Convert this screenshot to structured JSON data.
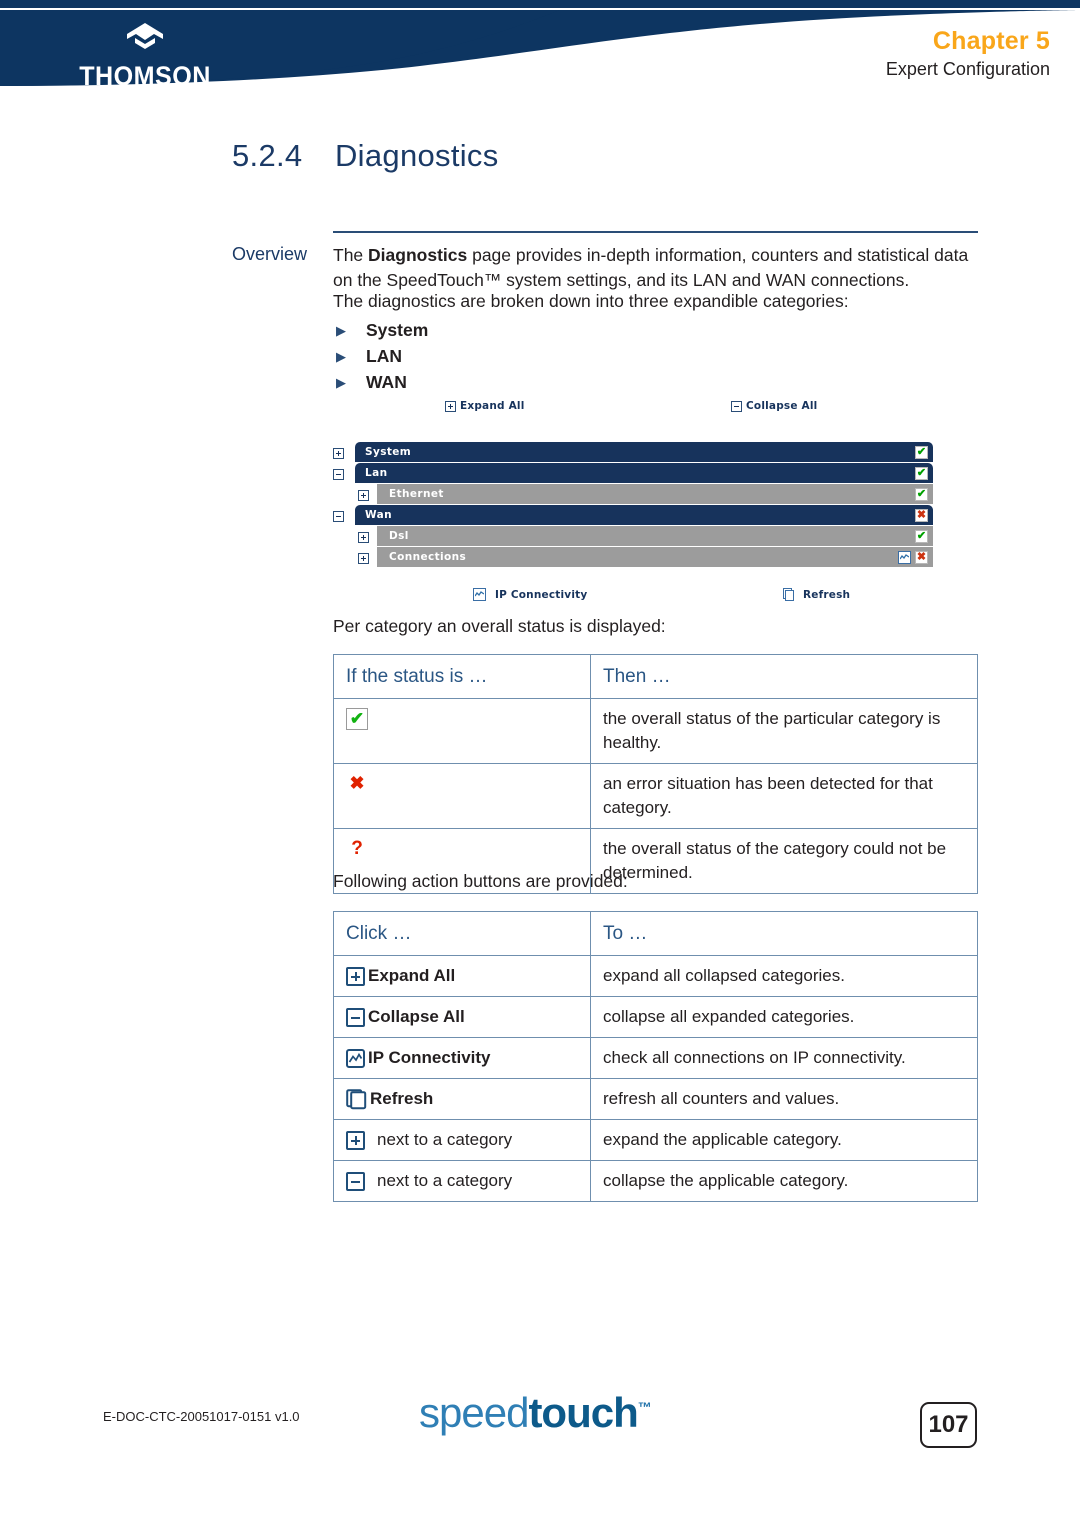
{
  "header": {
    "brand": "THOMSON",
    "brand_icon": "thomson-diamond-logo",
    "chapter": "Chapter 5",
    "chapter_subtitle": "Expert Configuration",
    "accent_color": "#f9a61a",
    "band_color": "#0d3561"
  },
  "section": {
    "number": "5.2.4",
    "title": "Diagnostics"
  },
  "overview": {
    "label": "Overview",
    "paragraph_prefix": "The ",
    "paragraph_bold": "Diagnostics",
    "paragraph_rest": " page provides in-depth information, counters and statistical data on the SpeedTouch™ system settings, and its LAN and WAN connections.",
    "categories_intro": "The diagnostics are broken down into three expandible categories:",
    "categories": [
      "System",
      "LAN",
      "WAN"
    ]
  },
  "ui_screenshot": {
    "expand_all_label": "Expand All",
    "collapse_all_label": "Collapse All",
    "ip_connectivity_label": "IP Connectivity",
    "refresh_label": "Refresh",
    "tree_rows": [
      {
        "label": "System",
        "level": 1,
        "toggle": "plus",
        "status": [
          "ok"
        ]
      },
      {
        "label": "Lan",
        "level": 1,
        "toggle": "minus",
        "status": [
          "ok"
        ]
      },
      {
        "label": "Ethernet",
        "level": 2,
        "toggle": "plus",
        "status": [
          "ok"
        ]
      },
      {
        "label": "Wan",
        "level": 1,
        "toggle": "minus",
        "status": [
          "err"
        ]
      },
      {
        "label": "Dsl",
        "level": 2,
        "toggle": "plus",
        "status": [
          "ok"
        ]
      },
      {
        "label": "Connections",
        "level": 2,
        "toggle": "plus",
        "status": [
          "graph",
          "err"
        ]
      }
    ],
    "colors": {
      "level1_bar": "#17335c",
      "level2_bar": "#9c9c9c",
      "ok": "#00a000",
      "error": "#cc3311"
    }
  },
  "status_table": {
    "intro": "Per category an overall status is displayed:",
    "headers": [
      "If the status is …",
      "Then …"
    ],
    "rows": [
      {
        "icon": "green-check-icon",
        "text": "the overall status of the particular category is healthy."
      },
      {
        "icon": "red-cross-icon",
        "text": "an error situation has been detected for that category."
      },
      {
        "icon": "question-mark-icon",
        "text": "the overall status of the category could not be determined."
      }
    ]
  },
  "actions_table": {
    "intro": "Following action buttons are provided:",
    "headers": [
      "Click …",
      "To …"
    ],
    "rows": [
      {
        "icon": "plus-square-icon",
        "label": "Expand All",
        "bold": true,
        "desc": "expand all collapsed categories."
      },
      {
        "icon": "minus-square-icon",
        "label": "Collapse All",
        "bold": true,
        "desc": "collapse all expanded categories."
      },
      {
        "icon": "ip-connectivity-icon",
        "label": "IP Connectivity",
        "bold": true,
        "desc": "check all connections on IP connectivity."
      },
      {
        "icon": "refresh-pages-icon",
        "label": "Refresh",
        "bold": true,
        "desc": "refresh all counters and values."
      },
      {
        "icon": "plus-square-icon",
        "label": "next to a category",
        "bold": false,
        "desc": "expand the applicable category."
      },
      {
        "icon": "minus-square-icon",
        "label": "next to a category",
        "bold": false,
        "desc": "collapse the applicable category."
      }
    ]
  },
  "footer": {
    "doc_id": "E-DOC-CTC-20051017-0151 v1.0",
    "logo_part1": "speed",
    "logo_part2": "touch",
    "logo_tm": "™",
    "page_number": "107"
  }
}
